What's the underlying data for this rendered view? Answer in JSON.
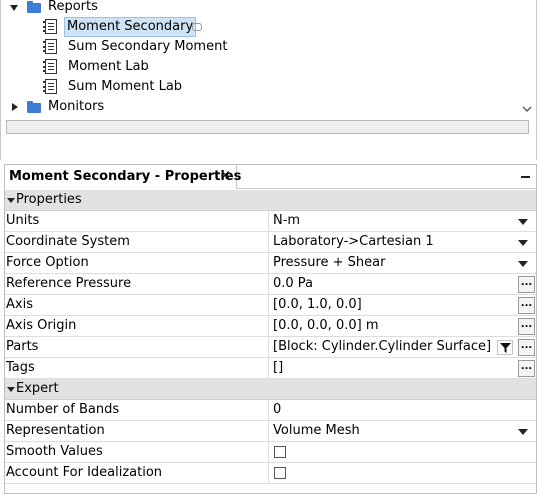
{
  "tree": {
    "items": [
      {
        "label": "Reports",
        "type": "folder",
        "expanded": true
      },
      {
        "label": "Moment Secondary",
        "type": "report",
        "selected": true
      },
      {
        "label": "Sum Secondary Moment",
        "type": "report"
      },
      {
        "label": "Moment Lab",
        "type": "report"
      },
      {
        "label": "Sum Moment Lab",
        "type": "report"
      },
      {
        "label": "Monitors",
        "type": "folder",
        "expanded": false
      }
    ]
  },
  "properties_panel": {
    "tab_title": "Moment Secondary - Properties",
    "close_glyph": "×",
    "sections": [
      {
        "title": "Properties",
        "rows": [
          {
            "name": "Units",
            "value": "N-m",
            "control": "dropdown"
          },
          {
            "name": "Coordinate System",
            "value": "Laboratory->Cartesian 1",
            "control": "dropdown"
          },
          {
            "name": "Force Option",
            "value": "Pressure + Shear",
            "control": "dropdown"
          },
          {
            "name": "Reference Pressure",
            "value": "0.0 Pa",
            "control": "ellipsis"
          },
          {
            "name": "Axis",
            "value": "[0.0, 1.0, 0.0]",
            "control": "ellipsis"
          },
          {
            "name": "Axis Origin",
            "value": "[0.0, 0.0, 0.0] m",
            "control": "ellipsis"
          },
          {
            "name": "Parts",
            "value": "[Block: Cylinder.Cylinder Surface]",
            "control": "filter-ellipsis"
          },
          {
            "name": "Tags",
            "value": "[]",
            "control": "ellipsis"
          }
        ]
      },
      {
        "title": "Expert",
        "rows": [
          {
            "name": "Number of Bands",
            "value": "0",
            "control": "text"
          },
          {
            "name": "Representation",
            "value": "Volume Mesh",
            "control": "dropdown"
          },
          {
            "name": "Smooth Values",
            "value": "",
            "control": "checkbox",
            "checked": false
          },
          {
            "name": "Account For Idealization",
            "value": "",
            "control": "checkbox",
            "checked": false
          }
        ]
      }
    ],
    "ellipsis_label": "..."
  },
  "colors": {
    "folder": "#3d7dd8",
    "selection_bg": "#cfe3f6",
    "section_bg": "#e2e2e2"
  }
}
